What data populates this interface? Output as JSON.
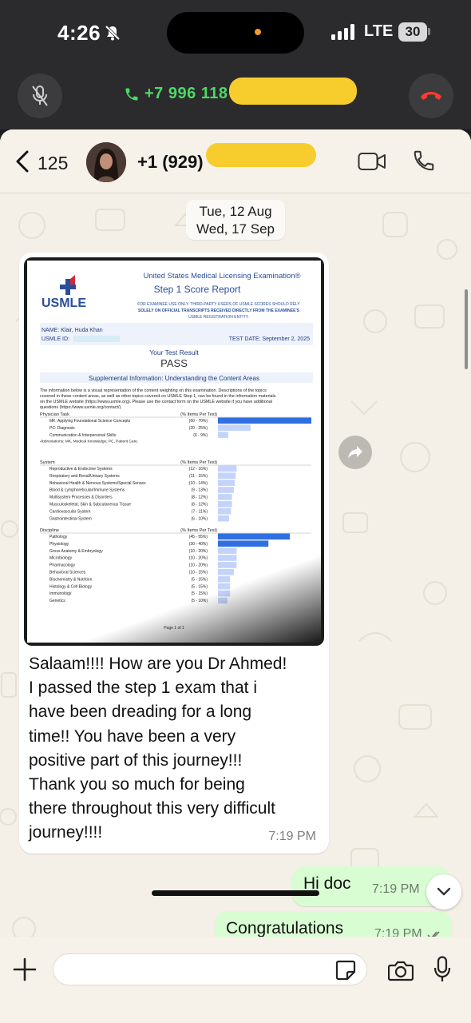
{
  "status_bar": {
    "time": "4:26",
    "network": "LTE",
    "battery": "30"
  },
  "call_banner": {
    "number": "+7 996 118"
  },
  "chat_header": {
    "back_count": "125",
    "contact": "+1 (929)"
  },
  "date_chip": {
    "line1": "Tue, 12 Aug",
    "line2": "Wed, 17 Sep"
  },
  "document": {
    "header_title": "United States Medical Licensing Examination®",
    "subtitle": "Step 1 Score Report",
    "logo_text": "USMLE",
    "notice_1": "FOR EXAMINEE USE ONLY. THIRD-PARTY USERS OF USMLE SCORES SHOULD RELY",
    "notice_2": "SOLELY ON OFFICIAL TRANSCRIPTS RECEIVED DIRECTLY FROM THE EXAMINEE'S",
    "notice_3": "USMLE REGISTRATION ENTITY.",
    "name_line": "NAME:  Klair, Huda Khan",
    "id_label": "USMLE ID:",
    "test_date": "TEST DATE:  September 2, 2025",
    "result_heading": "Your Test Result",
    "result": "PASS",
    "supplemental": "Supplemental Information: Understanding the Content Areas",
    "paragraph": [
      "The information below is a visual representation of the content weighting on this examination. Descriptions of the topics",
      "covered in these content areas, as well as other topics covered on USMLE Step 1, can be found in the information materials",
      "on the USMLE website (https://www.usmle.org). Please use the contact form on the USMLE website if you have additional",
      "questions (https://www.usmle.org/contact/)."
    ],
    "col_header": "(% Items Per Test)",
    "abbreviations": "Abbreviations: MK, Medical Knowledge; PC, Patient Care.",
    "page_footer": "Page 1 of 1",
    "sections": [
      {
        "title": "Physician Task",
        "items": [
          {
            "label": "MK: Applying Foundational Science Concepts",
            "range": "(60 - 70%)",
            "value": 1.0,
            "dark": true
          },
          {
            "label": "PC: Diagnosis",
            "range": "(20 - 25%)",
            "value": 0.35,
            "dark": false
          },
          {
            "label": "Communication & Interpersonal Skills",
            "range": "(6 - 9%)",
            "value": 0.11,
            "dark": false
          }
        ]
      },
      {
        "title": "System",
        "items": [
          {
            "label": "Reproductive & Endocrine Systems",
            "range": "(12 - 16%)",
            "value": 0.2,
            "dark": false
          },
          {
            "label": "Respiratory and Renal/Urinary Systems",
            "range": "(11 - 15%)",
            "value": 0.19,
            "dark": false
          },
          {
            "label": "Behavioral Health & Nervous Systems/Special Senses",
            "range": "(10 - 14%)",
            "value": 0.18,
            "dark": false
          },
          {
            "label": "Blood & Lymphoreticular/Immune Systems",
            "range": "(9 - 13%)",
            "value": 0.17,
            "dark": false
          },
          {
            "label": "Multisystem Processes & Disorders",
            "range": "(8 - 12%)",
            "value": 0.15,
            "dark": false
          },
          {
            "label": "Musculoskeletal, Skin & Subcutaneous Tissue",
            "range": "(8 - 12%)",
            "value": 0.15,
            "dark": false
          },
          {
            "label": "Cardiovascular System",
            "range": "(7 - 11%)",
            "value": 0.14,
            "dark": false
          },
          {
            "label": "Gastrointestinal System",
            "range": "(6 - 10%)",
            "value": 0.12,
            "dark": false
          }
        ]
      },
      {
        "title": "Discipline",
        "items": [
          {
            "label": "Pathology",
            "range": "(45 - 55%)",
            "value": 0.77,
            "dark": true
          },
          {
            "label": "Physiology",
            "range": "(30 - 40%)",
            "value": 0.54,
            "dark": true
          },
          {
            "label": "Gross Anatomy & Embryology",
            "range": "(10 - 20%)",
            "value": 0.2,
            "dark": false
          },
          {
            "label": "Microbiology",
            "range": "(10 - 20%)",
            "value": 0.2,
            "dark": false
          },
          {
            "label": "Pharmacology",
            "range": "(10 - 20%)",
            "value": 0.2,
            "dark": false
          },
          {
            "label": "Behavioral Sciences",
            "range": "(10 - 15%)",
            "value": 0.17,
            "dark": false
          },
          {
            "label": "Biochemistry & Nutrition",
            "range": "(5 - 15%)",
            "value": 0.13,
            "dark": false
          },
          {
            "label": "Histology & Cell Biology",
            "range": "(5 - 15%)",
            "value": 0.13,
            "dark": false
          },
          {
            "label": "Immunology",
            "range": "(5 - 15%)",
            "value": 0.13,
            "dark": false
          },
          {
            "label": "Genetics",
            "range": "(5 - 10%)",
            "value": 0.1,
            "dark": false
          }
        ]
      }
    ]
  },
  "incoming_message": {
    "lines": [
      "Salaam!!!! How are you Dr Ahmed!",
      "I passed the step 1 exam that i",
      "have been dreading for a long",
      "time!! You have been a very",
      "positive part of this journey!!!",
      "Thank you so much for being",
      "there throughout this very difficult",
      "journey!!!!"
    ],
    "time": "7:19 PM"
  },
  "outgoing_messages": [
    {
      "text": "Hi doc",
      "time": "7:19 PM"
    },
    {
      "text": "Congratulations",
      "time": "7:19 PM"
    }
  ],
  "colors": {
    "bar_dark": "#2f6fe0",
    "bar_light": "#c3d3fb",
    "outgoing": "#d9fdd3",
    "redact": "#f7cd2e"
  },
  "icons": [
    "bell-slash-icon",
    "signal-icon",
    "mic-off-icon",
    "phone-icon",
    "end-call-icon",
    "back-chevron-icon",
    "video-icon",
    "forward-icon",
    "chevron-down-icon",
    "plus-icon",
    "sticker-icon",
    "camera-icon",
    "mic-icon"
  ]
}
